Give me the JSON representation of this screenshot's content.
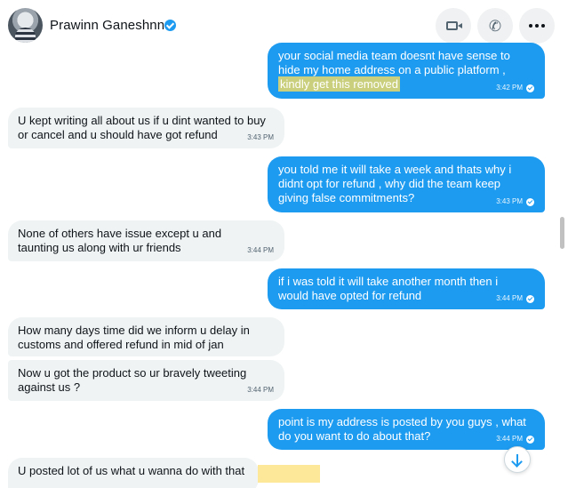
{
  "header": {
    "contact_name": "Prawinn Ganeshnn",
    "verified": true,
    "buttons": [
      "video-call",
      "voice-call",
      "more-options"
    ]
  },
  "colors": {
    "outgoing_bubble": "#1d9bf0",
    "incoming_bubble": "#eff3f4",
    "highlight": "#c9cf7c",
    "verified_badge": "#1d9bf0"
  },
  "messages": [
    {
      "direction": "out",
      "text_before": "your social media team doesnt have sense to hide my home address on a public platform , ",
      "text_highlight": "kindly get this removed",
      "time": "3:42 PM",
      "read": true
    },
    {
      "direction": "in",
      "text": "U kept writing all about us if u dint wanted to buy or cancel and u should have got refund",
      "time": "3:43 PM"
    },
    {
      "direction": "out",
      "text": "you told me it will take a week and thats why i didnt opt for refund , why did the team keep giving false commitments?",
      "time": "3:43 PM",
      "read": true
    },
    {
      "direction": "in",
      "text": "None of others have issue except u and taunting us along with ur friends",
      "time": "3:44 PM"
    },
    {
      "direction": "out",
      "text": "if i was told it will take another month then i would have opted for refund",
      "time": "3:44 PM",
      "read": true
    },
    {
      "direction": "in",
      "text": "How many days time did we inform u delay in customs and offered refund in mid of jan",
      "time": ""
    },
    {
      "direction": "in",
      "text": "Now u got the product so ur bravely tweeting against us ?",
      "time": "3:44 PM"
    },
    {
      "direction": "out",
      "text": "point is my address is posted by you guys , what do you want to do about that?",
      "time": "3:44 PM",
      "read": true
    },
    {
      "direction": "in",
      "text": "U posted lot of us what u wanna do with that",
      "time": ""
    }
  ]
}
